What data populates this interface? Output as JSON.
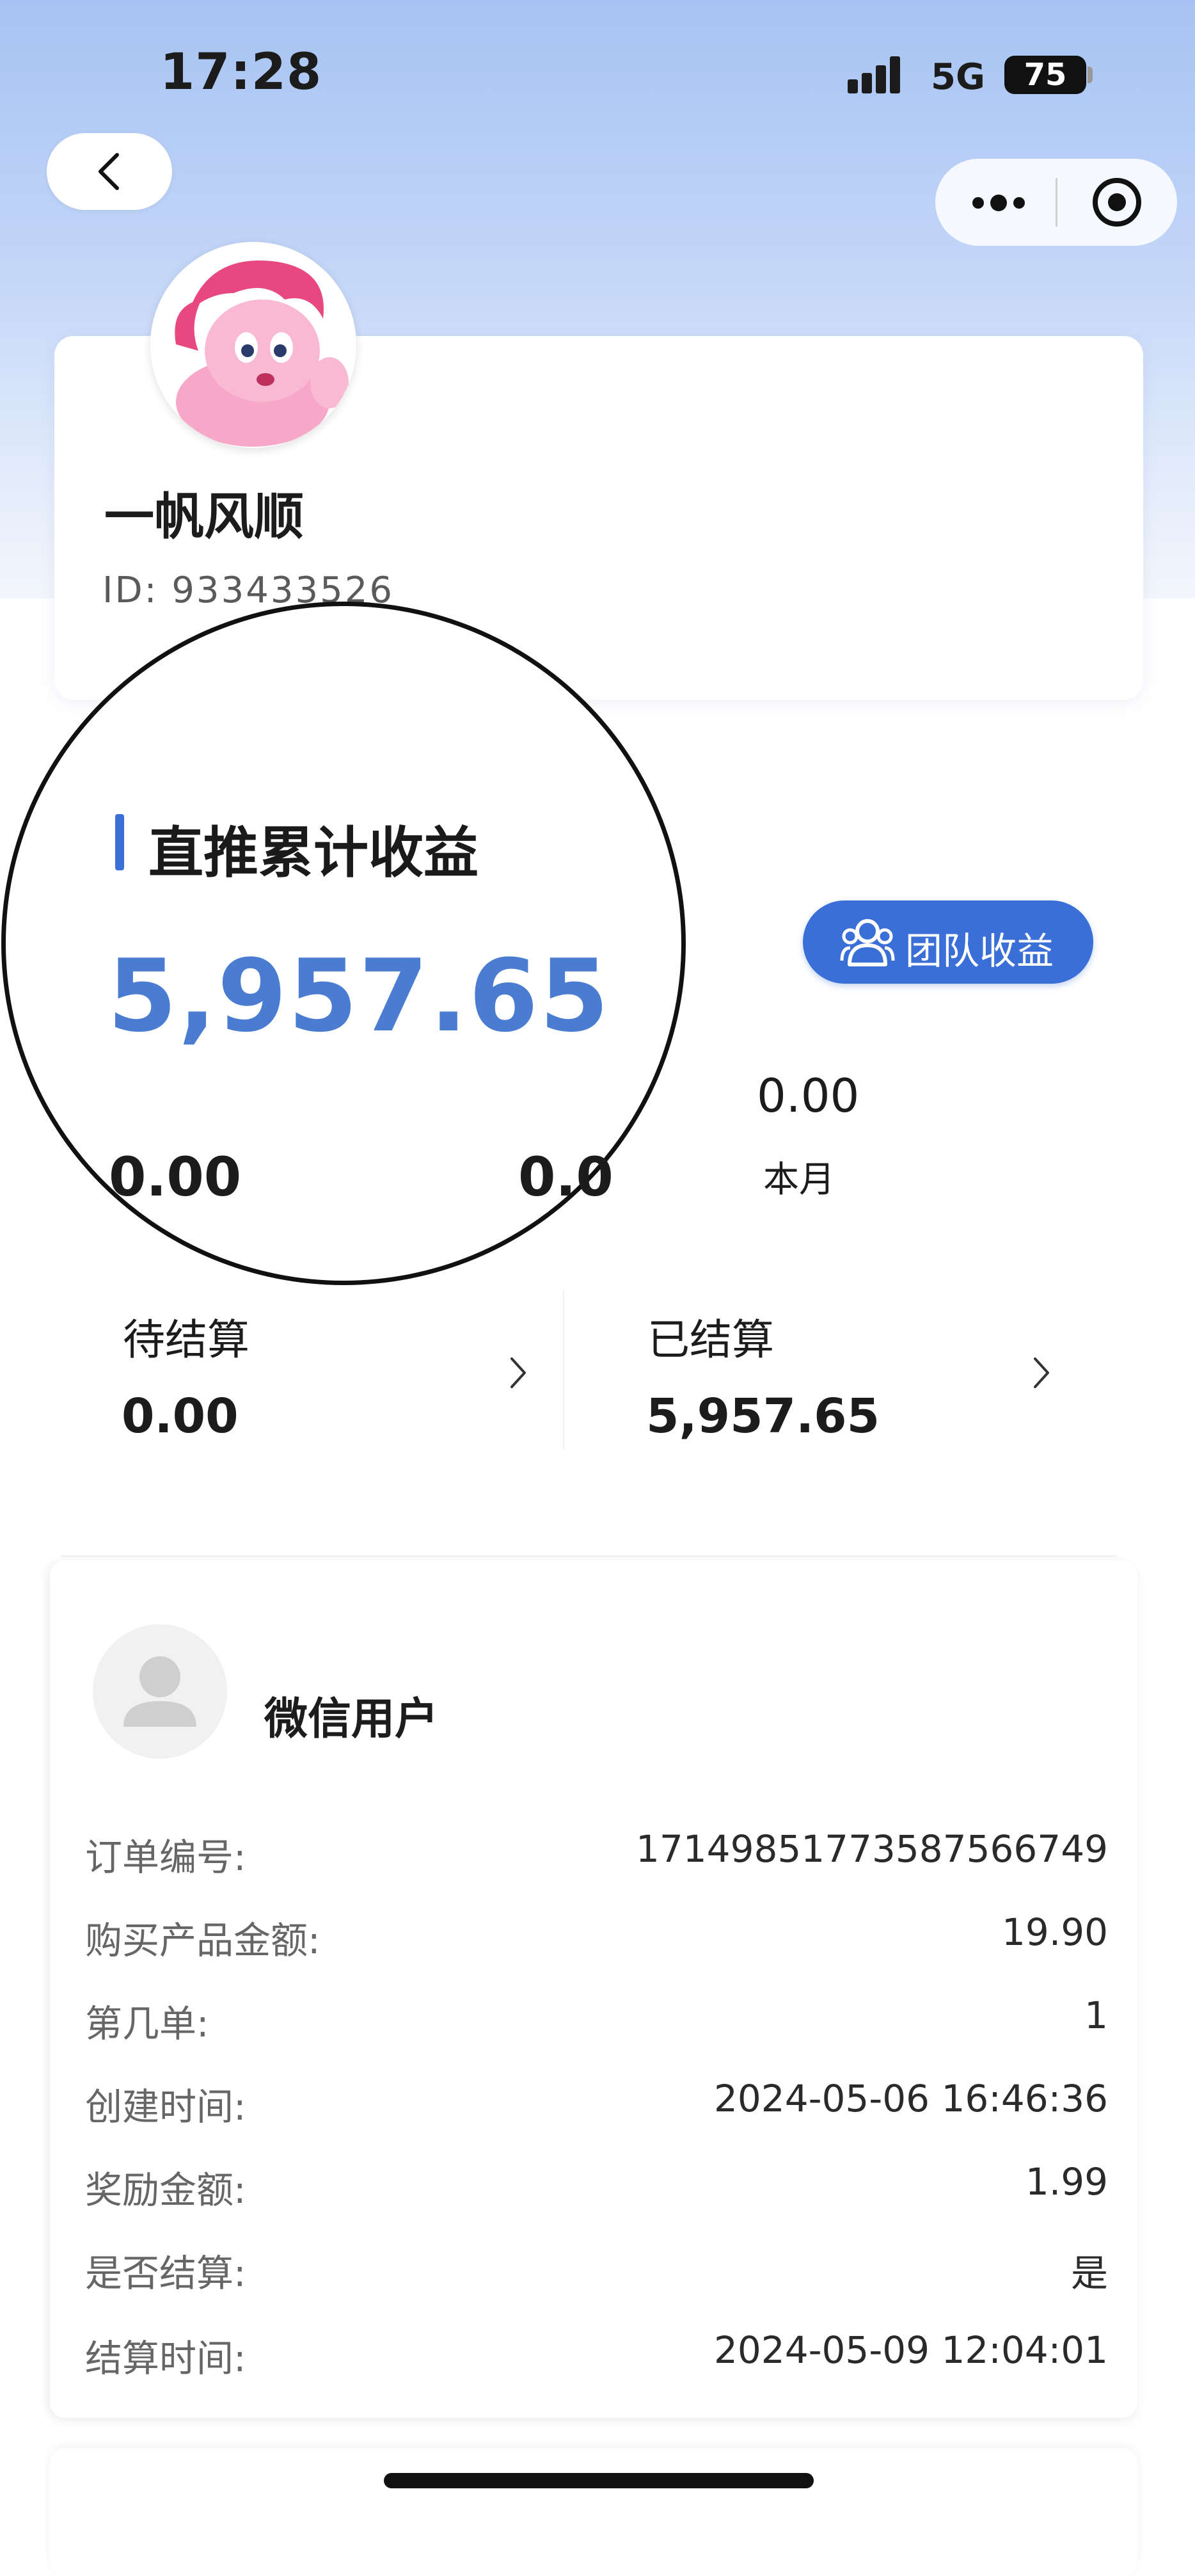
{
  "status_bar": {
    "time": "17:28",
    "network": "5G",
    "battery": "75"
  },
  "profile": {
    "nickname": "一帆风顺",
    "user_id": "ID: 933433526"
  },
  "earnings": {
    "section_title": "直推累计收益",
    "total": "5,957.65",
    "lens_value_1": "0.00",
    "lens_value_2": "0.0",
    "team_button": "团队收益",
    "month_value": "0.00",
    "month_label": "本月"
  },
  "settlement": {
    "pending_label": "待结算",
    "pending_value": "0.00",
    "settled_label": "已结算",
    "settled_value": "5,957.65"
  },
  "order": {
    "user_name": "微信用户",
    "rows": [
      {
        "label": "订单编号:",
        "value": "1714985177358756674​9"
      },
      {
        "label": "购买产品金额:",
        "value": "19.90"
      },
      {
        "label": "第几单:",
        "value": "1"
      },
      {
        "label": "创建时间:",
        "value": "2024-05-06 16:46:36"
      },
      {
        "label": "奖励金额:",
        "value": "1.99"
      },
      {
        "label": "是否结算:",
        "value": "是"
      },
      {
        "label": "结算时间:",
        "value": "2024-05-09 12:04:01"
      }
    ]
  },
  "icons": [
    "back-arrow-icon",
    "more-dots-icon",
    "record-target-icon",
    "team-people-icon",
    "chevron-right-icon",
    "user-placeholder-icon"
  ],
  "colors": {
    "accent": "#3a6fd8",
    "amount": "#4a7cd2",
    "header_gradient_top": "#a7c3f3"
  }
}
